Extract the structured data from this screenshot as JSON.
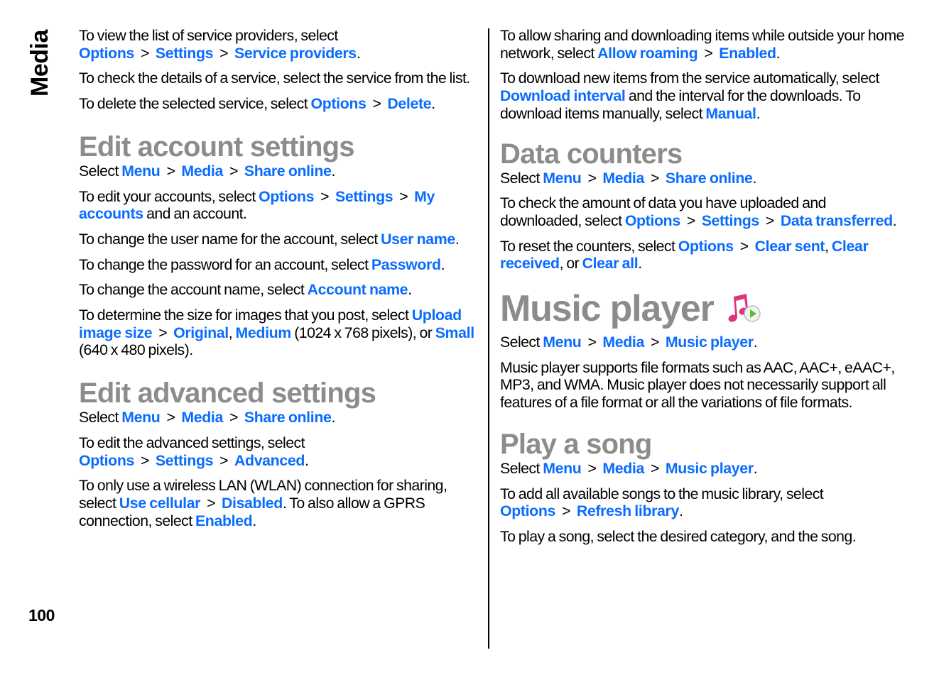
{
  "section_tab": "Media",
  "page_number": "100",
  "colors": {
    "link": "#0a6cff",
    "heading": "#8c8c8c",
    "text": "#000000"
  },
  "left_column": {
    "p1": {
      "t1": "To view the list of service providers, select ",
      "l1": "Options",
      "s1": ">",
      "l2": "Settings",
      "s2": ">",
      "l3": "Service providers",
      "t2": "."
    },
    "p2": {
      "t1": "To check the details of a service, select the service from the list."
    },
    "p3": {
      "t1": "To delete the selected service, select ",
      "l1": "Options",
      "s1": ">",
      "l2": "Delete",
      "t2": "."
    },
    "h_edit_account": "Edit account settings",
    "p4": {
      "t1": "Select ",
      "l1": "Menu",
      "s1": ">",
      "l2": "Media",
      "s2": ">",
      "l3": "Share online",
      "t2": "."
    },
    "p5": {
      "t1": "To edit your accounts, select ",
      "l1": "Options",
      "s1": ">",
      "l2": "Settings",
      "s2": ">",
      "l3": "My accounts",
      "t2": " and an account."
    },
    "p6": {
      "t1": "To change the user name for the account, select ",
      "l1": "User name",
      "t2": "."
    },
    "p7": {
      "t1": "To change the password for an account, select ",
      "l1": "Password",
      "t2": "."
    },
    "p8": {
      "t1": "To change the account name, select ",
      "l1": "Account name",
      "t2": "."
    },
    "p9": {
      "t1": "To determine the size for images that you post, select ",
      "l1": "Upload image size",
      "s1": ">",
      "l2": "Original",
      "t2": ", ",
      "l3": "Medium",
      "t3": " (1024 x 768 pixels), or ",
      "l4": "Small",
      "t4": " (640 x 480 pixels)."
    },
    "h_edit_advanced": "Edit advanced settings",
    "p10": {
      "t1": "Select ",
      "l1": "Menu",
      "s1": ">",
      "l2": "Media",
      "s2": ">",
      "l3": "Share online",
      "t2": "."
    },
    "p11": {
      "t1": "To edit the advanced settings, select ",
      "l1": "Options",
      "s1": ">",
      "l2": "Settings",
      "s2": ">",
      "l3": "Advanced",
      "t2": "."
    },
    "p12": {
      "t1": "To only use a wireless LAN (WLAN) connection for sharing, select ",
      "l1": "Use cellular",
      "s1": ">",
      "l2": "Disabled",
      "t2": ". To also allow a GPRS connection, select ",
      "l3": "Enabled",
      "t3": "."
    }
  },
  "right_column": {
    "p1": {
      "t1": "To allow sharing and downloading items while outside your home network, select ",
      "l1": "Allow roaming",
      "s1": ">",
      "l2": "Enabled",
      "t2": "."
    },
    "p2": {
      "t1": "To download new items from the service automatically, select ",
      "l1": "Download interval",
      "t2": " and the interval for the downloads. To download items manually, select ",
      "l2": "Manual",
      "t3": "."
    },
    "h_data_counters": "Data counters",
    "p3": {
      "t1": "Select ",
      "l1": "Menu",
      "s1": ">",
      "l2": "Media",
      "s2": ">",
      "l3": "Share online",
      "t2": "."
    },
    "p4": {
      "t1": "To check the amount of data you have uploaded and downloaded, select ",
      "l1": "Options",
      "s1": ">",
      "l2": "Settings",
      "s2": ">",
      "l3": "Data transferred",
      "t2": "."
    },
    "p5": {
      "t1": "To reset the counters, select ",
      "l1": "Options",
      "s1": ">",
      "l2": "Clear sent",
      "t2": ", ",
      "l3": "Clear received",
      "t3": ", or ",
      "l4": "Clear all",
      "t4": "."
    },
    "h_music_player": "Music player",
    "music_icon": "music-player-icon",
    "p6": {
      "t1": "Select ",
      "l1": "Menu",
      "s1": ">",
      "l2": "Media",
      "s2": ">",
      "l3": "Music player",
      "t2": "."
    },
    "p7": {
      "t1": "Music player supports file formats such as AAC, AAC+, eAAC+, MP3, and WMA. Music player does not necessarily support all features of a file format or all the variations of file formats."
    },
    "h_play_song": "Play a song",
    "p8": {
      "t1": "Select ",
      "l1": "Menu",
      "s1": ">",
      "l2": "Media",
      "s2": ">",
      "l3": "Music player",
      "t2": "."
    },
    "p9": {
      "t1": "To add all available songs to the music library, select ",
      "l1": "Options",
      "s1": ">",
      "l2": "Refresh library",
      "t2": "."
    },
    "p10": {
      "t1": "To play a song, select the desired category, and the song."
    }
  }
}
